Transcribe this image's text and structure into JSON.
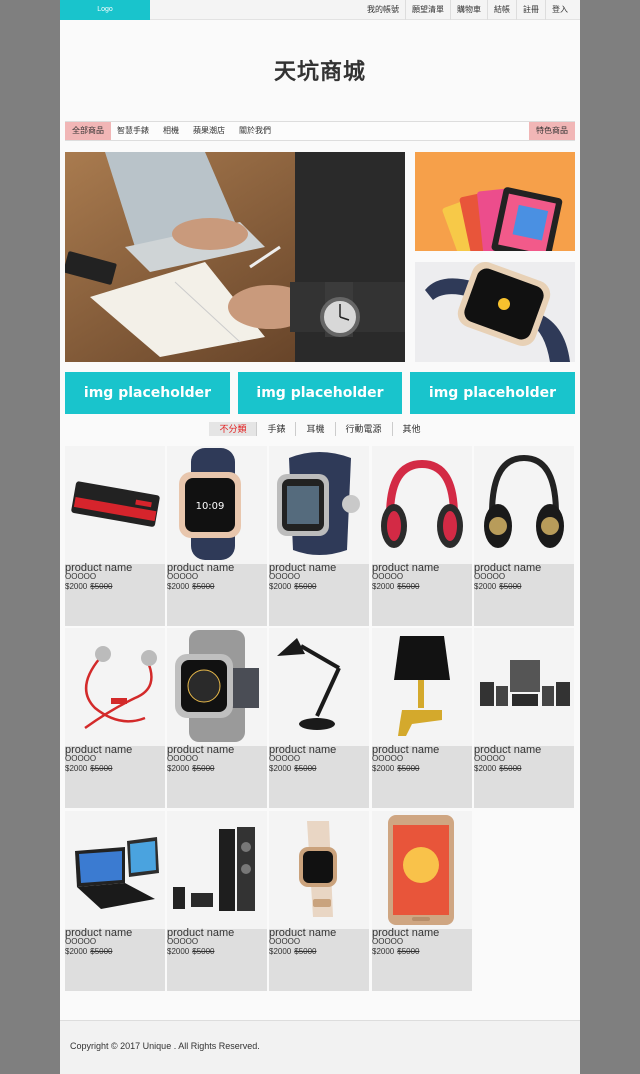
{
  "topbar": {
    "logo": "Logo",
    "nav": [
      "我的帳號",
      "願望清單",
      "購物車",
      "結帳",
      "註冊",
      "登入"
    ]
  },
  "site_title": "天坑商城",
  "catnav": {
    "items": [
      "全部商品",
      "智慧手錶",
      "相機",
      "蘋果潮店",
      "關於我們"
    ],
    "featured": "特色商品"
  },
  "placeholders": [
    "img placeholder",
    "img placeholder",
    "img placeholder"
  ],
  "filters": {
    "items": [
      "不分類",
      "手錶",
      "耳機",
      "行動電源",
      "其他"
    ],
    "active": "不分類"
  },
  "product_card": {
    "name": "product name",
    "rating": "OOOOO",
    "price": "$2000",
    "old_price": "$5000"
  },
  "products": [
    {
      "icon": "power-bank-icon"
    },
    {
      "icon": "smartwatch-rose-gold-icon"
    },
    {
      "icon": "smartwatch-steel-icon"
    },
    {
      "icon": "headphones-red-icon"
    },
    {
      "icon": "headphones-black-icon"
    },
    {
      "icon": "earphones-red-icon"
    },
    {
      "icon": "smartwatch-milanese-icon"
    },
    {
      "icon": "desk-lamp-icon"
    },
    {
      "icon": "table-lamp-gold-icon"
    },
    {
      "icon": "speaker-set-icon"
    },
    {
      "icon": "laptop-icon"
    },
    {
      "icon": "tower-speakers-icon"
    },
    {
      "icon": "smartwatch-leather-icon"
    },
    {
      "icon": "smartphone-gold-icon"
    }
  ],
  "footer": {
    "copyright": "Copyright © 2017 Unique . All Rights Reserved."
  },
  "colors": {
    "accent": "#19c4cc",
    "highlight": "#f1b6b6",
    "filter_active_text": "#e21b1b"
  }
}
